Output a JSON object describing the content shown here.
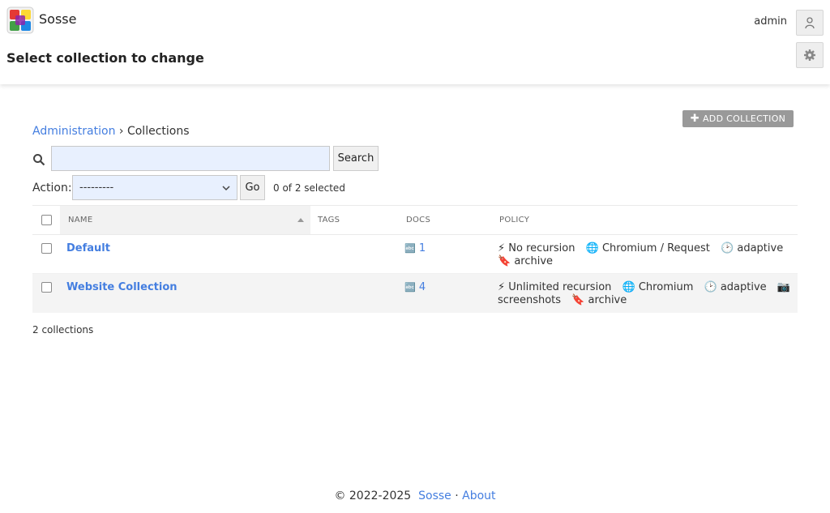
{
  "app": {
    "name": "Sosse",
    "page_title": "Select collection to change",
    "user": "admin"
  },
  "toolbar": {
    "add_label": "ADD COLLECTION"
  },
  "breadcrumb": {
    "root": "Administration",
    "separator": "›",
    "current": "Collections"
  },
  "search": {
    "value": "",
    "button_label": "Search"
  },
  "actions": {
    "label": "Action:",
    "selected_value": "---------",
    "go_label": "Go",
    "selected_count": "0 of 2 selected"
  },
  "table": {
    "headers": {
      "name": "NAME",
      "tags": "TAGS",
      "docs": "DOCS",
      "policy": "POLICY"
    },
    "rows": [
      {
        "name": "Default",
        "tags": "",
        "docs": "1",
        "policy": {
          "recursion": "No recursion",
          "browser": "Chromium / Request",
          "schedule": "adaptive",
          "extra1": "",
          "extra2": "archive"
        }
      },
      {
        "name": "Website Collection",
        "tags": "",
        "docs": "4",
        "policy": {
          "recursion": "Unlimited recursion",
          "browser": "Chromium",
          "schedule": "adaptive",
          "extra1": "screenshots",
          "extra2": "archive"
        }
      }
    ],
    "count_text": "2 collections"
  },
  "footer": {
    "copyright": "© 2022-2025",
    "link1": "Sosse",
    "separator": "·",
    "link2": "About"
  },
  "colors": {
    "link": "#447ee0",
    "add_button_bg": "#999999",
    "input_bg": "#e8f0fe"
  },
  "icons": {
    "logo": "sosse-logo",
    "search": "magnifier-icon",
    "user": "user-icon",
    "settings": "gear-icon"
  }
}
